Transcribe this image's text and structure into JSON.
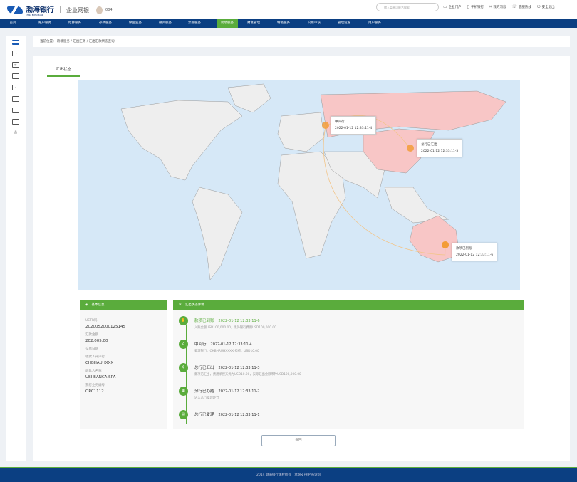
{
  "header": {
    "bank_name": "渤海银行",
    "bank_name_en": "CHINA BOHAI BANK",
    "portal": "企业网银",
    "user": "004",
    "search_placeholder": "输入菜单功能名搜索",
    "links": [
      {
        "icon": "monitor-icon",
        "label": "企业门户"
      },
      {
        "icon": "phone-icon",
        "label": "手机银行"
      },
      {
        "icon": "message-icon",
        "label": "我的消息"
      },
      {
        "icon": "headset-icon",
        "label": "客服热线"
      },
      {
        "icon": "logout-icon",
        "label": "安全退出"
      }
    ]
  },
  "nav": {
    "items": [
      "首页",
      "账户服务",
      "结算服务",
      "存款服务",
      "保函业务",
      "融资服务",
      "票据服务",
      "跨境服务",
      "财富管理",
      "特色服务",
      "交易审核",
      "管理设置",
      "用户服务"
    ],
    "active": "跨境服务"
  },
  "sidebar": {
    "icons": [
      "menu-icon",
      "login-icon",
      "logout-icon",
      "card-icon",
      "archive-icon",
      "wallet-icon",
      "box-icon",
      "folder-icon",
      "network-icon"
    ]
  },
  "breadcrumb": "当前位置： 跨境服务 / 汇出汇款 / 汇出汇款状态查询",
  "tab": "汇出状态",
  "map_markers": [
    {
      "title": "中间行",
      "time": "2022-01-12 12:33:11-4"
    },
    {
      "title": "总行已汇出",
      "time": "2022-01-12 12:33:11-3"
    },
    {
      "title": "款项已到账",
      "time": "2022-01-12 12:33:11-6"
    }
  ],
  "basic_info": {
    "title": "基本信息",
    "fields": [
      {
        "label": "UETR码",
        "value": "2020052000125145"
      },
      {
        "label": "汇款金额",
        "value": "202,005.00"
      },
      {
        "label": "交易日期",
        "value": ""
      },
      {
        "label": "收款人开户行",
        "value": "CHBHAUHXXX"
      },
      {
        "label": "收款人名称",
        "value": "UBI BANCA SPA"
      },
      {
        "label": "我行业务编号",
        "value": "ORC1112"
      }
    ]
  },
  "status_detail": {
    "title": "汇出状态详情",
    "steps": [
      {
        "icon": "hand-icon",
        "glyph": "✋",
        "title": "款项已到账",
        "time": "2022-01-12 12:33:11-6",
        "desc": "入账金额USD100,000.00，境外银行费用USD100,000.00"
      },
      {
        "icon": "bank-icon",
        "glyph": "🏛",
        "title": "中间行",
        "time": "2022-01-12 12:33:11-4",
        "desc": "处理银行：CHBHRUHXXXX 扣费：USD10.00"
      },
      {
        "icon": "money-icon",
        "glyph": "$",
        "title": "总行已汇出",
        "time": "2022-01-12 12:33:11-3",
        "desc": "款项已汇出，费用承担方式为USD10.00，实际汇出金额币种USD100,000.00"
      },
      {
        "icon": "building-icon",
        "glyph": "▦",
        "title": "分行已办结",
        "time": "2022-01-12 12:33:11-2",
        "desc": "进入总行受理环节"
      },
      {
        "icon": "clipboard-icon",
        "glyph": "▤",
        "title": "总行已受理",
        "time": "2022-01-12 12:33:11-1",
        "desc": ""
      }
    ]
  },
  "return_button": "返回",
  "footer": "2014 渤海银行版权所有　本站支持IPv6访问",
  "colors": {
    "nav": "#0b3f82",
    "accent": "#5aac3c",
    "highlight_country": "#f8c6c6",
    "marker": "#f39c38"
  }
}
